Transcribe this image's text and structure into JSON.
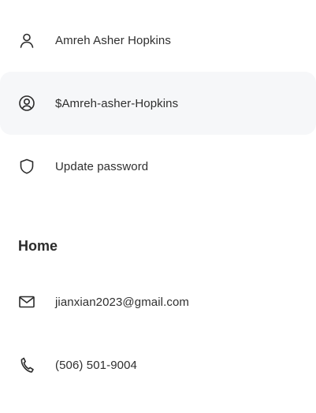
{
  "account": {
    "items": [
      {
        "label": "Amreh Asher Hopkins",
        "icon": "person-icon"
      },
      {
        "label": "$Amreh-asher-Hopkins",
        "icon": "user-circle-icon"
      },
      {
        "label": "Update password",
        "icon": "shield-icon"
      }
    ]
  },
  "home": {
    "title": "Home",
    "items": [
      {
        "label": "jianxian2023@gmail.com",
        "icon": "mail-icon"
      },
      {
        "label": "(506) 501-9004",
        "icon": "phone-icon"
      }
    ]
  },
  "colors": {
    "highlight_bg": "#f6f7f9",
    "text": "#2f2f2f"
  }
}
